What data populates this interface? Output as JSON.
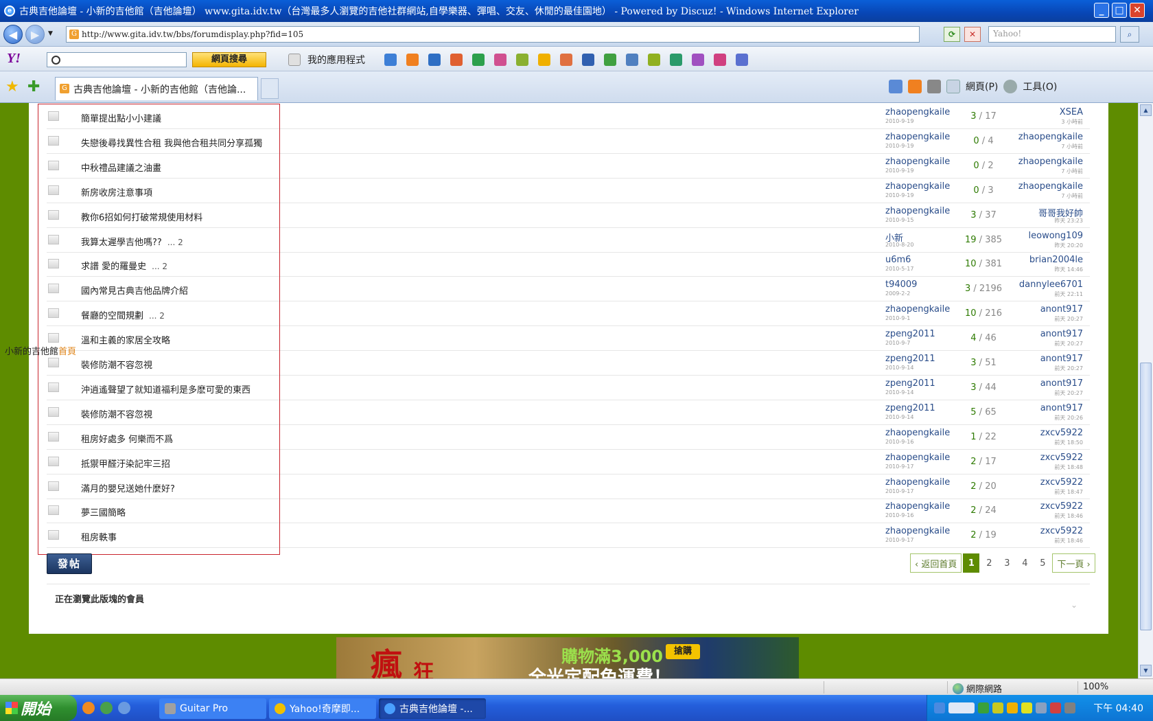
{
  "window": {
    "title": "古典吉他論壇 - 小新的吉他館（吉他論壇） www.gita.idv.tw（台灣最多人瀏覽的吉他社群網站,自學樂器、彈唱、交友、休閒的最佳園地） - Powered by Discuz! - Windows Internet Explorer"
  },
  "address": {
    "url": "http://www.gita.idv.tw/bbs/forumdisplay.php?fid=105",
    "search_placeholder": "Yahoo!"
  },
  "yahoo_toolbar": {
    "search_button": "網頁搜尋",
    "apps_label": "我的應用程式"
  },
  "tab": {
    "label": "古典吉他論壇 - 小新的吉他館（吉他論..."
  },
  "command_bar": {
    "page_label": "網頁(P)",
    "tools_label": "工具(O)"
  },
  "sidebar_label": {
    "site": "小新的吉他館",
    "home": "首頁"
  },
  "threads": [
    {
      "title": "簡單提出點小小建議",
      "pages": "",
      "author": "zhaopengkaile",
      "date": "2010-9-19",
      "replies": "3",
      "views": "17",
      "last_user": "XSEA",
      "last_time": "3 小時前"
    },
    {
      "title": "失戀後尋找異性合租 我與他合租共同分享孤獨",
      "pages": "",
      "author": "zhaopengkaile",
      "date": "2010-9-19",
      "replies": "0",
      "views": "4",
      "last_user": "zhaopengkaile",
      "last_time": "7 小時前"
    },
    {
      "title": "中秋禮品建議之油畫",
      "pages": "",
      "author": "zhaopengkaile",
      "date": "2010-9-19",
      "replies": "0",
      "views": "2",
      "last_user": "zhaopengkaile",
      "last_time": "7 小時前"
    },
    {
      "title": "新房收房注意事項",
      "pages": "",
      "author": "zhaopengkaile",
      "date": "2010-9-19",
      "replies": "0",
      "views": "3",
      "last_user": "zhaopengkaile",
      "last_time": "7 小時前"
    },
    {
      "title": "教你6招如何打破常規使用材料",
      "pages": "",
      "author": "zhaopengkaile",
      "date": "2010-9-15",
      "replies": "3",
      "views": "37",
      "last_user": "哥哥我好帥",
      "last_time": "昨天 23:23"
    },
    {
      "title": "我算太遲學吉他嗎??",
      "pages": "... 2",
      "author": "小新",
      "date": "2010-8-20",
      "replies": "19",
      "views": "385",
      "last_user": "leowong109",
      "last_time": "昨天 20:20"
    },
    {
      "title": "求譜 愛的羅曼史",
      "pages": "... 2",
      "author": "u6m6",
      "date": "2010-5-17",
      "replies": "10",
      "views": "381",
      "last_user": "brian2004le",
      "last_time": "昨天 14:46"
    },
    {
      "title": "國內常見古典吉他品牌介紹",
      "pages": "",
      "author": "t94009",
      "date": "2009-2-2",
      "replies": "3",
      "views": "2196",
      "last_user": "dannylee6701",
      "last_time": "前天 22:11"
    },
    {
      "title": "餐廳的空間規劃",
      "pages": "... 2",
      "author": "zhaopengkaile",
      "date": "2010-9-1",
      "replies": "10",
      "views": "216",
      "last_user": "anont917",
      "last_time": "前天 20:27"
    },
    {
      "title": "溫和主義的家居全攻略",
      "pages": "",
      "author": "zpeng2011",
      "date": "2010-9-7",
      "replies": "4",
      "views": "46",
      "last_user": "anont917",
      "last_time": "前天 20:27"
    },
    {
      "title": "裝修防潮不容忽視",
      "pages": "",
      "author": "zpeng2011",
      "date": "2010-9-14",
      "replies": "3",
      "views": "51",
      "last_user": "anont917",
      "last_time": "前天 20:27"
    },
    {
      "title": "沖逍遙聲望了就知道福利是多麽可愛的東西",
      "pages": "",
      "author": "zpeng2011",
      "date": "2010-9-14",
      "replies": "3",
      "views": "44",
      "last_user": "anont917",
      "last_time": "前天 20:27"
    },
    {
      "title": "裝修防潮不容忽視",
      "pages": "",
      "author": "zpeng2011",
      "date": "2010-9-14",
      "replies": "5",
      "views": "65",
      "last_user": "anont917",
      "last_time": "前天 20:26"
    },
    {
      "title": "租房好處多 何樂而不爲",
      "pages": "",
      "author": "zhaopengkaile",
      "date": "2010-9-16",
      "replies": "1",
      "views": "22",
      "last_user": "zxcv5922",
      "last_time": "前天 18:50"
    },
    {
      "title": "抵禦甲醛汙染記牢三招",
      "pages": "",
      "author": "zhaopengkaile",
      "date": "2010-9-17",
      "replies": "2",
      "views": "17",
      "last_user": "zxcv5922",
      "last_time": "前天 18:48"
    },
    {
      "title": "滿月的嬰兒送她什麼好?",
      "pages": "",
      "author": "zhaopengkaile",
      "date": "2010-9-17",
      "replies": "2",
      "views": "20",
      "last_user": "zxcv5922",
      "last_time": "前天 18:47"
    },
    {
      "title": "夢三國簡略",
      "pages": "",
      "author": "zhaopengkaile",
      "date": "2010-9-16",
      "replies": "2",
      "views": "24",
      "last_user": "zxcv5922",
      "last_time": "前天 18:46"
    },
    {
      "title": "租房軼事",
      "pages": "",
      "author": "zhaopengkaile",
      "date": "2010-9-17",
      "replies": "2",
      "views": "19",
      "last_user": "zxcv5922",
      "last_time": "前天 18:46"
    }
  ],
  "post_button": "發帖",
  "pager": {
    "back": "‹ 返回首頁",
    "pages": [
      "1",
      "2",
      "3",
      "4",
      "5"
    ],
    "current": "1",
    "next": "下一頁 ›"
  },
  "viewers_label": "正在瀏覽此版塊的會員",
  "banner": {
    "big1": "瘋",
    "big2": "狂",
    "promo": "購物滿3,000",
    "promo2": "全光定配免運費！",
    "buy": "搶購"
  },
  "status_bar": {
    "zone": "網際網路",
    "zoom": "100%"
  },
  "taskbar": {
    "start": "開始",
    "tasks": [
      "Guitar Pro",
      "Yahoo!奇摩即...",
      "古典吉他論壇 -..."
    ],
    "clock": "下午 04:40"
  },
  "colors": {
    "page_bg": "#5e8c00",
    "highlight_box": "#c8232c",
    "link": "#2a4d8a"
  }
}
